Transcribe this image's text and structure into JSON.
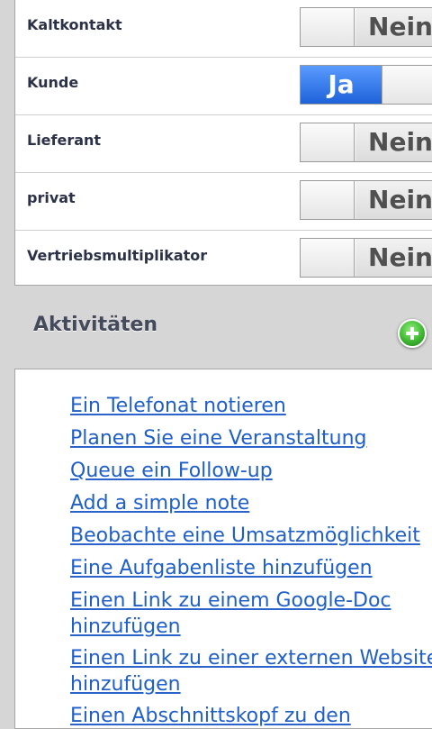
{
  "toggles": [
    {
      "label": "Kaltkontakt",
      "state": "Nein",
      "on": false
    },
    {
      "label": "Kunde",
      "state": "Ja",
      "on": true
    },
    {
      "label": "Lieferant",
      "state": "Nein",
      "on": false
    },
    {
      "label": "privat",
      "state": "Nein",
      "on": false
    },
    {
      "label": "Vertriebsmultiplikator",
      "state": "Nein",
      "on": false
    }
  ],
  "activities": {
    "title": "Aktivitäten",
    "add_icon": "plus-circle-icon",
    "links": [
      {
        "line1": "Ein Telefonat notieren"
      },
      {
        "line1": "Planen Sie eine Veranstaltung"
      },
      {
        "line1": "Queue ein Follow-up"
      },
      {
        "line1": "Add a simple note"
      },
      {
        "line1": "Beobachte eine Umsatzmöglichkeit"
      },
      {
        "line1": "Eine Aufgabenliste hinzufügen"
      },
      {
        "line1": "Einen Link zu einem Google-Doc",
        "line2": "hinzufügen"
      },
      {
        "line1": "Einen Link zu einer externen Website",
        "line2": "hinzufügen"
      },
      {
        "line1": "Einen Abschnittskopf zu den"
      }
    ]
  },
  "colors": {
    "background": "#d6d6d6",
    "link": "#1f5fc9",
    "toggle_on": "#2f74e6",
    "add_button": "#3fb832"
  }
}
